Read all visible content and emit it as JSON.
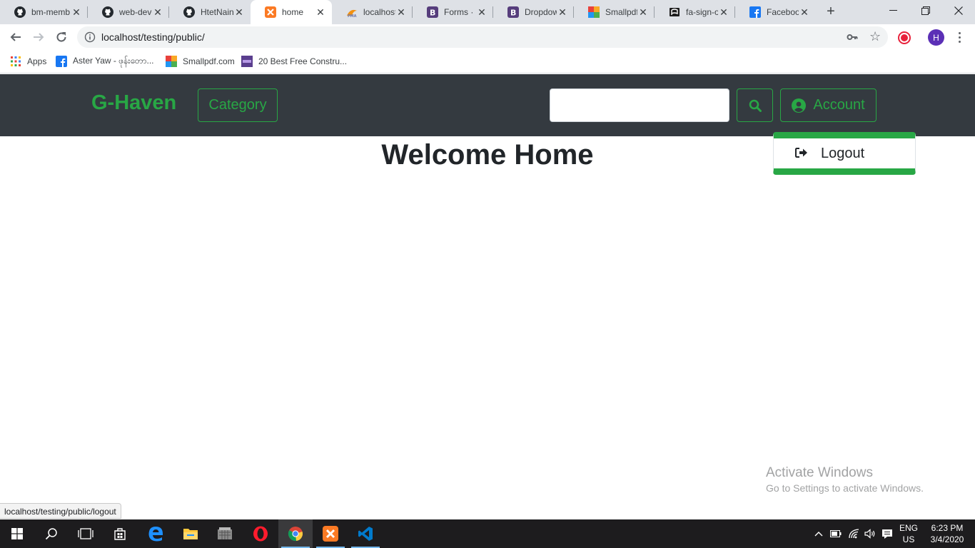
{
  "browser": {
    "tabs": [
      {
        "label": "bm-memb",
        "icon": "github-icon"
      },
      {
        "label": "web-devel",
        "icon": "github-icon"
      },
      {
        "label": "HtetNaing",
        "icon": "github-icon"
      },
      {
        "label": "home",
        "icon": "xampp-icon",
        "active": true
      },
      {
        "label": "localhost /",
        "icon": "phpmyadmin-icon"
      },
      {
        "label": "Forms · B",
        "icon": "bootstrap-icon"
      },
      {
        "label": "Dropdown",
        "icon": "bootstrap-icon"
      },
      {
        "label": "Smallpdf.c",
        "icon": "smallpdf-icon"
      },
      {
        "label": "fa-sign-ou",
        "icon": "fontawesome-icon"
      },
      {
        "label": "Facebook",
        "icon": "facebook-icon"
      }
    ],
    "url": "localhost/testing/public/",
    "profile_initial": "H",
    "bookmarks": [
      {
        "label": "Apps",
        "icon": "apps-grid-icon"
      },
      {
        "label": "Aster Yaw - ဖုန်းတော...",
        "icon": "facebook-icon"
      },
      {
        "label": "Smallpdf.com",
        "icon": "smallpdf-icon"
      },
      {
        "label": "20 Best Free Constru...",
        "icon": "colorlib-icon"
      }
    ],
    "status_url": "localhost/testing/public/logout"
  },
  "page": {
    "brand": "G-Haven",
    "category_label": "Category",
    "search_value": "",
    "account_label": "Account",
    "heading": "Welcome Home",
    "dropdown": {
      "logout_label": "Logout"
    }
  },
  "colors": {
    "accent": "#28a745",
    "navbar_bg": "#343a40"
  },
  "windows": {
    "watermark_title": "Activate Windows",
    "watermark_sub": "Go to Settings to activate Windows.",
    "lang_top": "ENG",
    "lang_bottom": "US",
    "time": "6:23 PM",
    "date": "3/4/2020"
  }
}
